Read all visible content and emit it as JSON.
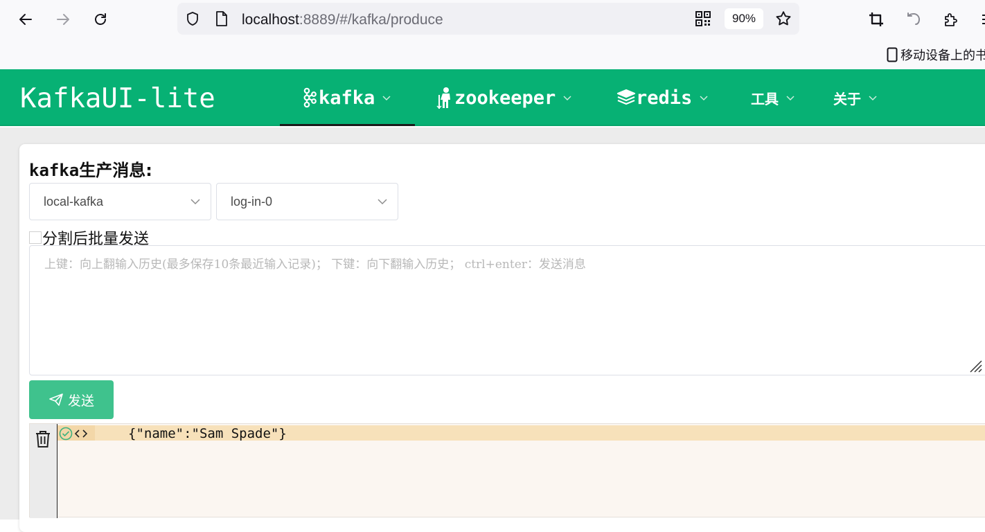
{
  "browser": {
    "url_host": "localhost",
    "url_rest": ":8889/#/kafka/produce",
    "zoom": "90%",
    "bookmark_label": "移动设备上的书"
  },
  "app": {
    "brand": "KafkaUI-lite",
    "menu": [
      {
        "label": "kafka",
        "active": true
      },
      {
        "label": "zookeeper",
        "active": false
      },
      {
        "label": "redis",
        "active": false
      },
      {
        "label": "工具",
        "active": false
      },
      {
        "label": "关于",
        "active": false
      }
    ]
  },
  "produce": {
    "title_en": "kafka",
    "title_cn": "生产消息:",
    "cluster_select": "local-kafka",
    "topic_select": "log-in-0",
    "batch_checkbox_label": "分割后批量发送",
    "batch_checked": false,
    "message_placeholder": "上键：向上翻输入历史(最多保存10条最近输入记录)； 下键：向下翻输入历史； ctrl+enter：发送消息",
    "send_label": "发送"
  },
  "log": {
    "entries": [
      {
        "status": "success",
        "text": "{\"name\":\"Sam Spade\"}"
      }
    ]
  },
  "colors": {
    "header_green": "#07b174",
    "send_button": "#3fc28d",
    "log_row_highlight": "#f7e1ba",
    "success_icon": "#3fb27f"
  }
}
